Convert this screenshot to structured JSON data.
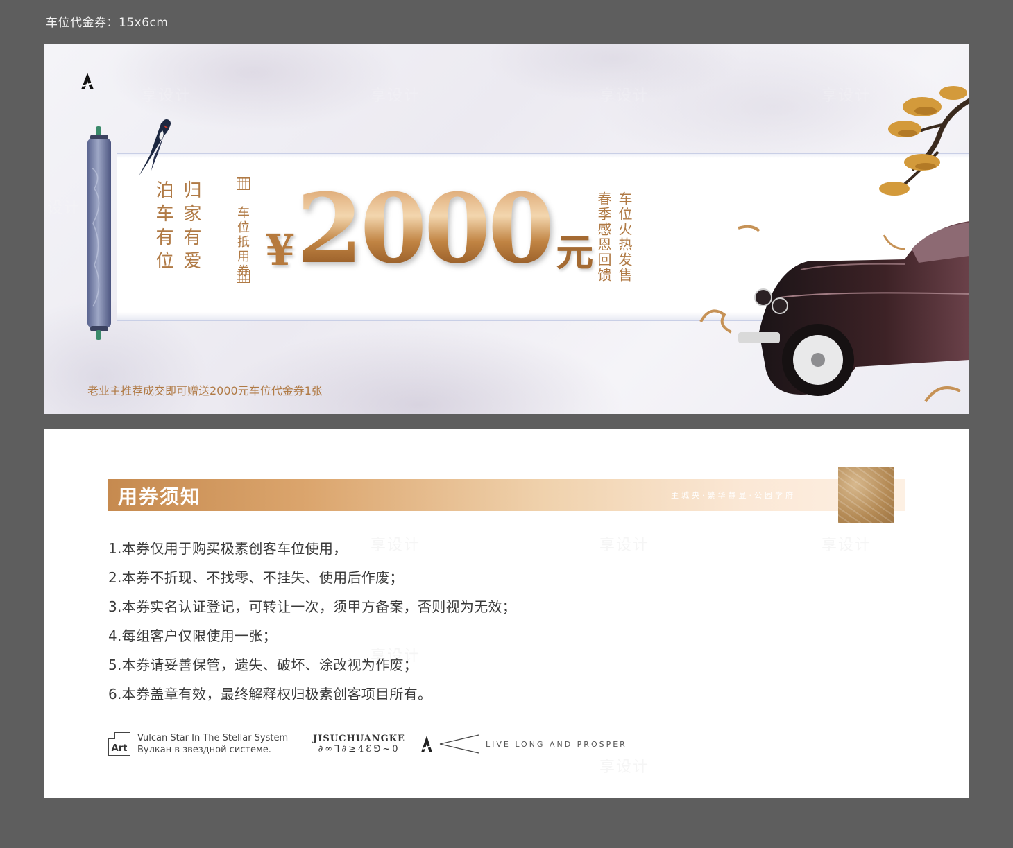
{
  "spec_label": "车位代金券：15x6cm",
  "front": {
    "slogan_columns": [
      "归家有爱",
      "泊车有位"
    ],
    "voucher_type": "车位抵用券",
    "amount": {
      "currency": "¥",
      "number": "2000",
      "unit": "元"
    },
    "promo_columns": [
      "车位火热发售",
      "春季感恩回馈"
    ],
    "footnote": "老业主推荐成交即可赠送2000元车位代金券1张",
    "icons": [
      "brand-a-icon",
      "scroll-icon",
      "swallow-icon",
      "pine-icon",
      "vintage-car-icon"
    ]
  },
  "back": {
    "notice_title": "用券须知",
    "notice_tagline": "主城央·繁华静显·公园学府",
    "rules": [
      "1.本券仅用于购买极素创客车位使用，",
      "2.本券不折现、不找零、不挂失、使用后作废；",
      "3.本券实名认证登记，可转让一次，须甲方备案，否则视为无效；",
      "4.每组客户仅限使用一张；",
      "5.本券请妥善保管，遗失、破坏、涂改视为作废；",
      "6.本券盖章有效，最终解释权归极素创客项目所有。"
    ],
    "footer": {
      "art_logo_text": "Art",
      "art_line1": "Vulcan Star In The Stellar System",
      "art_line2": "Вулкан в звездной системе.",
      "brand_top": "JISUCHUANGKE",
      "brand_bottom": "∂∞⅂∂≥4Ɛ⅁~0",
      "tagline": "LIVE LONG AND PROSPER"
    }
  },
  "colors": {
    "background": "#5e5e5e",
    "gold_text": "#b07a45",
    "gold_gradient_start": "#c68a4f",
    "gold_gradient_end": "#fdf0e3"
  }
}
